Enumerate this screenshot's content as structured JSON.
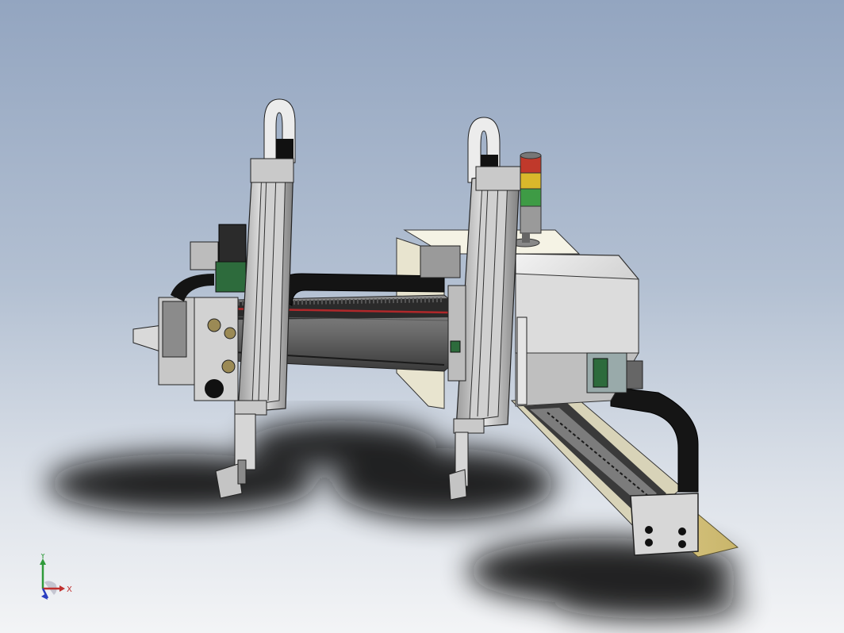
{
  "viewport": {
    "background_top": "#93a5c0",
    "background_bottom": "#f3f4f6"
  },
  "model": {
    "part_label": "",
    "signal_tower_colors": [
      "#c0392b",
      "#d9b82b",
      "#3e9b45",
      "#9a9a9a"
    ],
    "frame_color": "#cfcfcf",
    "cable_chain_color": "#151515",
    "accent_red": "#b0282a",
    "plate_color": "#e8d9a0"
  },
  "triad": {
    "x_label": "X",
    "y_label": "Y",
    "x_color": "#c0302f",
    "y_color": "#2f9a3a",
    "z_color": "#2b3fc0"
  }
}
